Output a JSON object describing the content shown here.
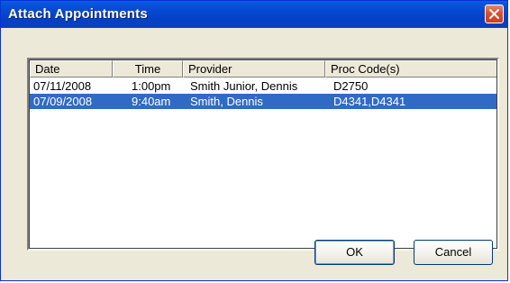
{
  "window": {
    "title": "Attach Appointments"
  },
  "list": {
    "columns": [
      "Date",
      "Time",
      "Provider",
      "Proc Code(s)"
    ],
    "rows": [
      {
        "date": "07/11/2008",
        "time": "1:00pm",
        "provider": "Smith Junior, Dennis",
        "proc_codes": "D2750",
        "selected": false
      },
      {
        "date": "07/09/2008",
        "time": "9:40am",
        "provider": "Smith, Dennis",
        "proc_codes": "D4341,D4341",
        "selected": true
      }
    ]
  },
  "buttons": {
    "ok_label": "OK",
    "cancel_label": "Cancel"
  },
  "colors": {
    "titlebar": "#0548d0",
    "selection": "#316ac5",
    "dialog_bg": "#ece9d8",
    "close_button": "#d8512e"
  },
  "icons": {
    "close": "close-icon"
  }
}
